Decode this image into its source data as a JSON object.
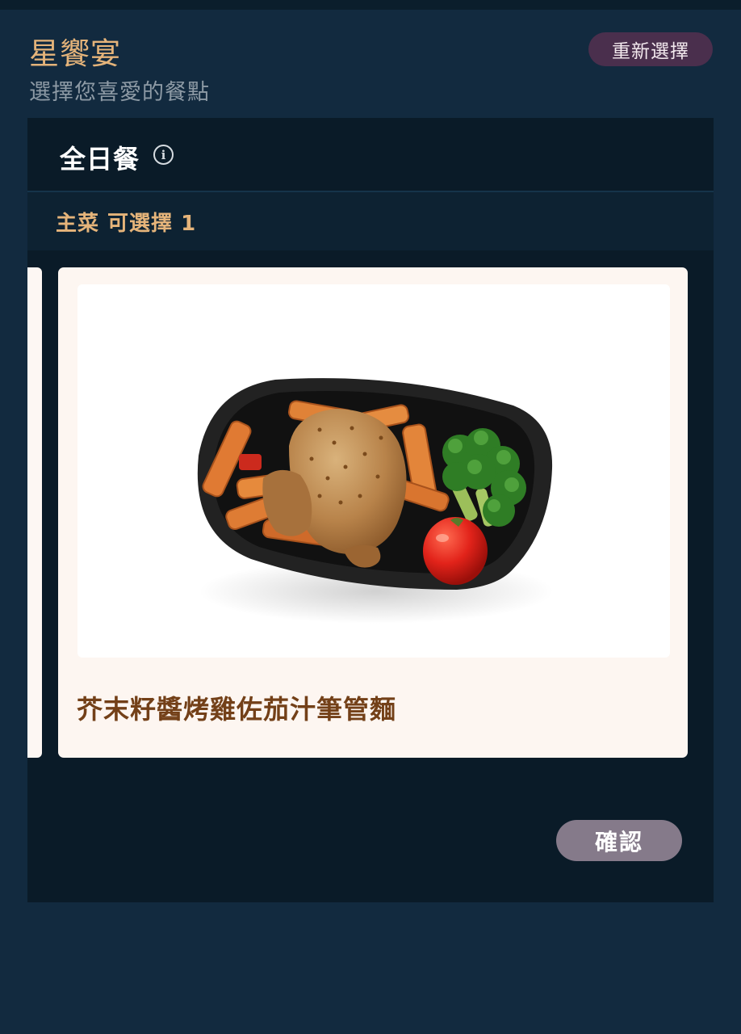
{
  "header": {
    "brand": "星饗宴",
    "subtitle": "選擇您喜愛的餐點",
    "reset_label": "重新選擇"
  },
  "menu": {
    "title": "全日餐",
    "info_icon": "info-circle-icon",
    "section_label": "主菜 可選擇 1"
  },
  "meal_card": {
    "name": "芥末籽醬烤雞佐茄汁筆管麵",
    "image": "grilled-chicken-penne-photo"
  },
  "actions": {
    "confirm_label": "確認"
  },
  "colors": {
    "background": "#122a3f",
    "panel": "#0a1b28",
    "accent_gold": "#e5b47a",
    "reset_button": "#4a2f4d",
    "confirm_button": "#857a8a",
    "card_background": "#fdf6f1",
    "card_title": "#734018"
  }
}
